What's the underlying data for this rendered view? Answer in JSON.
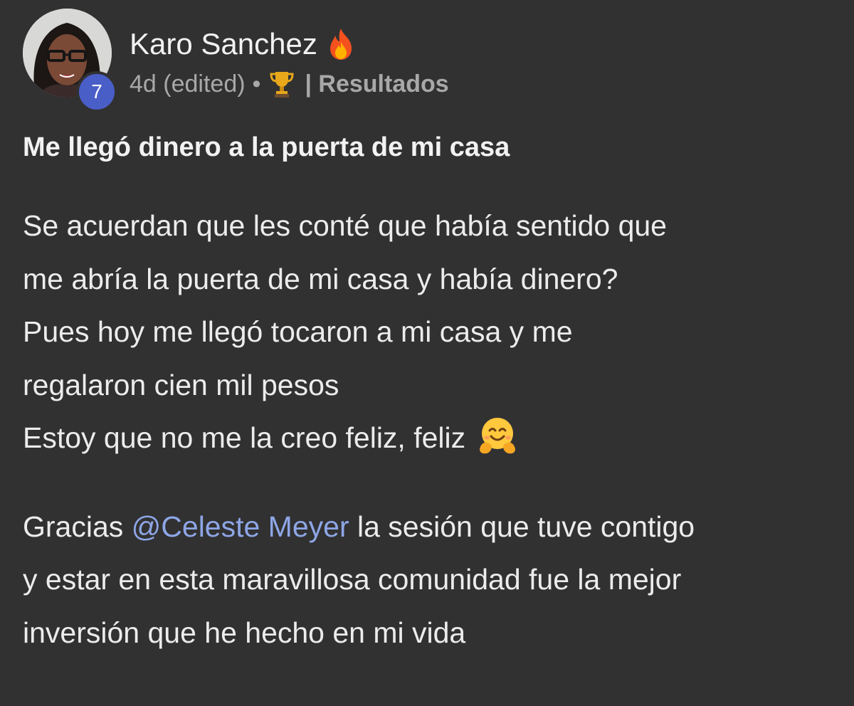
{
  "author": {
    "name": "Karo Sanchez",
    "level": "7",
    "name_badge_icon": "fire-icon"
  },
  "meta": {
    "timestamp": "4d (edited)",
    "separator": "•",
    "trophy_icon": "trophy-icon",
    "category": "| Resultados"
  },
  "post": {
    "title": "Me llegó dinero a la puerta de mi casa",
    "lines": [
      "Se acuerdan que les conté que había sentido que",
      "me abría la puerta de mi casa y había dinero?",
      "Pues hoy me llegó tocaron a mi casa y me",
      "regalaron cien mil pesos",
      "Estoy que no me la creo feliz, feliz"
    ],
    "emoji": "hugging-face-icon",
    "thanks_prefix": "Gracias ",
    "mention": "@Celeste Meyer",
    "thanks_line1_rest": " la sesión que tuve contigo",
    "thanks_line2": "y estar en esta maravillosa comunidad fue la mejor",
    "thanks_line3": "inversión que he hecho en mi vida"
  },
  "colors": {
    "background": "#313132",
    "badge": "#4a5ec8",
    "mention": "#8ea6e6",
    "meta_text": "#a8a8a8"
  }
}
